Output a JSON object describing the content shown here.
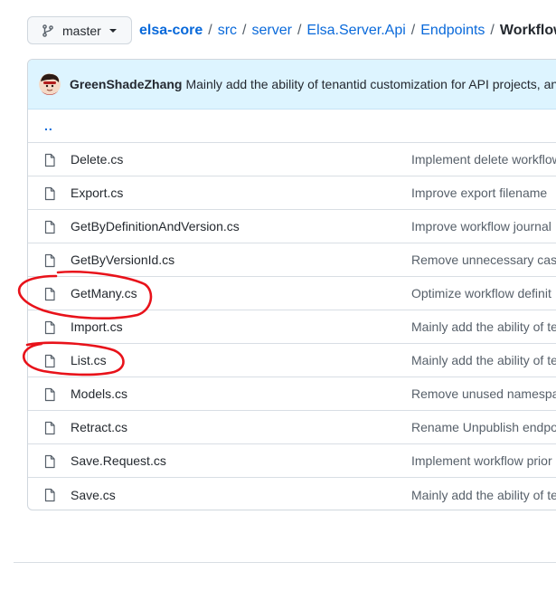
{
  "branch": {
    "name": "master"
  },
  "breadcrumb": {
    "repo": "elsa-core",
    "segments": [
      "src",
      "server",
      "Elsa.Server.Api",
      "Endpoints"
    ],
    "current": "WorkflowDe",
    "separator": "/"
  },
  "commit": {
    "author": "GreenShadeZhang",
    "message": "Mainly add the ability of tenantid customization for API projects, an"
  },
  "parent_dir_label": "..",
  "files": [
    {
      "name": "Delete.cs",
      "commit": "Implement delete workflow"
    },
    {
      "name": "Export.cs",
      "commit": "Improve export filename"
    },
    {
      "name": "GetByDefinitionAndVersion.cs",
      "commit": "Improve workflow journal"
    },
    {
      "name": "GetByVersionId.cs",
      "commit": "Remove unnecessary cast"
    },
    {
      "name": "GetMany.cs",
      "commit": "Optimize workflow definit"
    },
    {
      "name": "Import.cs",
      "commit": "Mainly add the ability of te"
    },
    {
      "name": "List.cs",
      "commit": "Mainly add the ability of te"
    },
    {
      "name": "Models.cs",
      "commit": "Remove unused namespac"
    },
    {
      "name": "Retract.cs",
      "commit": "Rename Unpublish endpo"
    },
    {
      "name": "Save.Request.cs",
      "commit": "Implement workflow prior"
    },
    {
      "name": "Save.cs",
      "commit": "Mainly add the ability of te"
    }
  ],
  "colors": {
    "link": "#0969da",
    "commit_bar_bg": "#ddf4ff",
    "annotation": "#e8121a"
  },
  "icons": {
    "branch": "git-branch-icon",
    "caret": "caret-down-icon",
    "file": "file-icon",
    "avatar": "user-avatar"
  },
  "annotations": [
    {
      "type": "hand-drawn-circle",
      "target": "GetMany.cs"
    },
    {
      "type": "hand-drawn-circle",
      "target": "List.cs"
    }
  ]
}
